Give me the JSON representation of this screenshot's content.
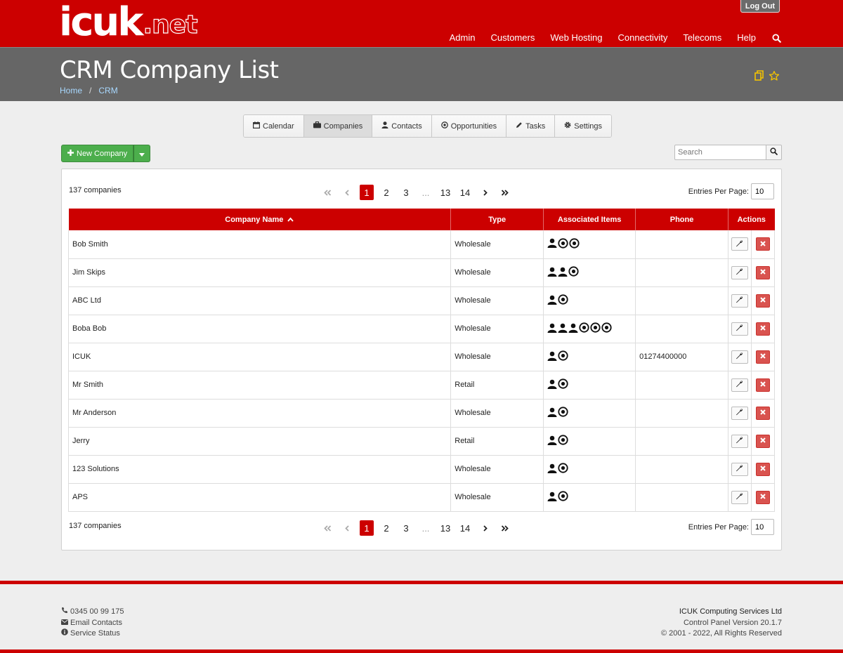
{
  "header": {
    "logo_main": "icuk",
    "logo_tld": ".net",
    "logout_label": "Log Out",
    "nav": [
      "Admin",
      "Customers",
      "Web Hosting",
      "Connectivity",
      "Telecoms",
      "Help"
    ],
    "nav_search_icon": "search-icon"
  },
  "titleband": {
    "title": "CRM Company List",
    "breadcrumb": [
      "Home",
      "CRM"
    ],
    "breadcrumb_sep": "/"
  },
  "crm_tabs": [
    {
      "label": "Calendar",
      "icon": "calendar-icon"
    },
    {
      "label": "Companies",
      "icon": "briefcase-icon",
      "active": true
    },
    {
      "label": "Contacts",
      "icon": "user-icon"
    },
    {
      "label": "Opportunities",
      "icon": "target-icon"
    },
    {
      "label": "Tasks",
      "icon": "pencil-icon"
    },
    {
      "label": "Settings",
      "icon": "gear-icon"
    }
  ],
  "toolbar": {
    "new_company_label": "New Company",
    "search_placeholder": "Search"
  },
  "list": {
    "count_label": "137 companies",
    "entries_label": "Entries Per Page:",
    "entries_value": "10",
    "pages": [
      "1",
      "2",
      "3",
      "...",
      "13",
      "14"
    ],
    "current_page": "1",
    "columns": [
      "Company Name",
      "Type",
      "Associated Items",
      "Phone",
      "Actions"
    ],
    "rows": [
      {
        "name": "Bob Smith",
        "type": "Wholesale",
        "contacts": 1,
        "opps": 2,
        "phone": ""
      },
      {
        "name": "Jim Skips",
        "type": "Wholesale",
        "contacts": 2,
        "opps": 1,
        "phone": ""
      },
      {
        "name": "ABC Ltd",
        "type": "Wholesale",
        "contacts": 1,
        "opps": 1,
        "phone": ""
      },
      {
        "name": "Boba Bob",
        "type": "Wholesale",
        "contacts": 3,
        "opps": 3,
        "phone": ""
      },
      {
        "name": "ICUK",
        "type": "Wholesale",
        "contacts": 1,
        "opps": 1,
        "phone": "01274400000"
      },
      {
        "name": "Mr Smith",
        "type": "Retail",
        "contacts": 1,
        "opps": 1,
        "phone": ""
      },
      {
        "name": "Mr Anderson",
        "type": "Wholesale",
        "contacts": 1,
        "opps": 1,
        "phone": ""
      },
      {
        "name": "Jerry",
        "type": "Retail",
        "contacts": 1,
        "opps": 1,
        "phone": ""
      },
      {
        "name": "123 Solutions",
        "type": "Wholesale",
        "contacts": 1,
        "opps": 1,
        "phone": ""
      },
      {
        "name": "APS",
        "type": "Wholesale",
        "contacts": 1,
        "opps": 1,
        "phone": ""
      }
    ]
  },
  "footer": {
    "phone": "0345 00 99 175",
    "email": "Email Contacts",
    "status": "Service Status",
    "company": "ICUK Computing Services Ltd",
    "version": "Control Panel Version 20.1.7",
    "copyright": "© 2001 - 2022, All Rights Reserved"
  },
  "colors": {
    "brand_red": "#cc0000",
    "title_grey": "#666666",
    "success_green": "#4cae4c",
    "danger_red": "#d9534f"
  }
}
